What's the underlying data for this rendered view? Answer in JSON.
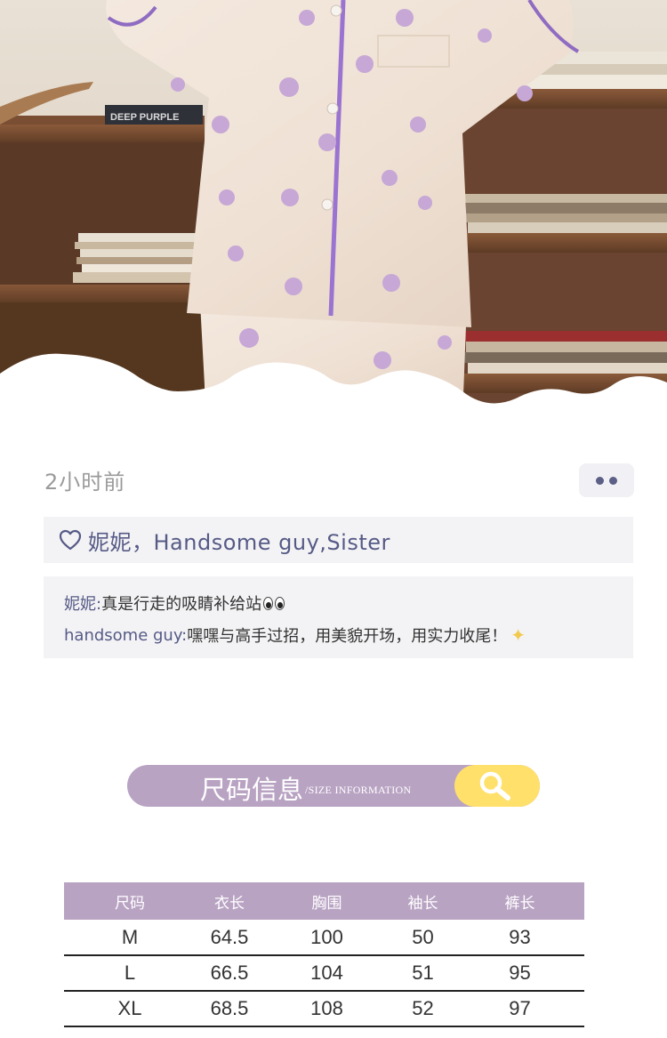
{
  "hero": {
    "book_spine_text": "DEEP PURPLE",
    "photo": "woman-in-floral-satin-pajamas"
  },
  "moment": {
    "time": "2小时前",
    "more_icon": "more-dots-icon",
    "likes_icon": "heart-outline-icon",
    "likes": "妮妮，Handsome guy,Sister",
    "comments": [
      {
        "name": "妮妮:",
        "text": "真是行走的吸睛补给站"
      },
      {
        "name": "handsome guy:",
        "text": "嘿嘿与高手过招，用美貌开场，用实力收尾！"
      }
    ]
  },
  "banner": {
    "title": "尺码信息",
    "subtitle": "/SIZE INFORMATION",
    "icon": "search-icon"
  },
  "size_table": {
    "headers": [
      "尺码",
      "衣长",
      "胸围",
      "袖长",
      "裤长"
    ],
    "rows": [
      [
        "M",
        "64.5",
        "100",
        "50",
        "93"
      ],
      [
        "L",
        "66.5",
        "104",
        "51",
        "95"
      ],
      [
        "XL",
        "68.5",
        "108",
        "52",
        "97"
      ]
    ]
  },
  "colors": {
    "accent_purple": "#b9a3c3",
    "name_color": "#565a86",
    "search_yellow": "#ffe06a",
    "panel_bg": "#f3f3f5"
  }
}
